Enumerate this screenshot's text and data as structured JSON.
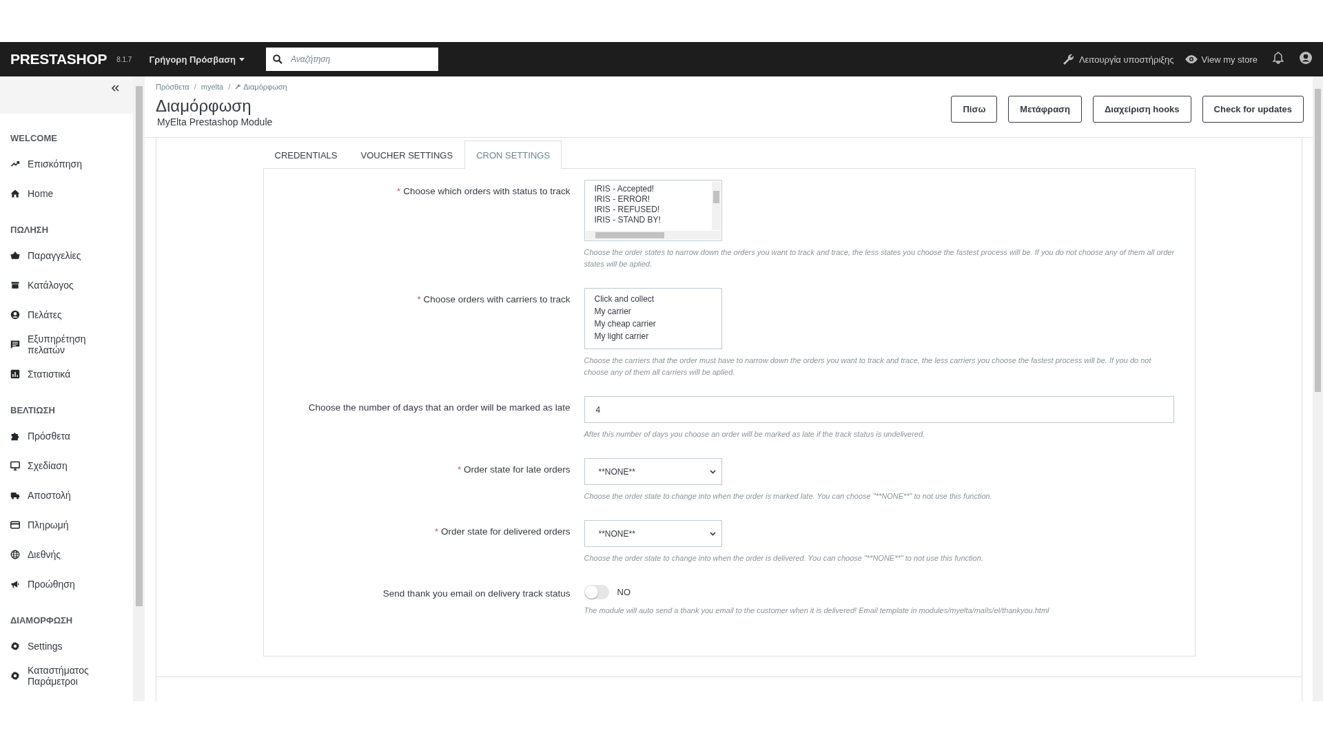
{
  "navbar": {
    "logo": "PRESTASHOP",
    "version": "8.1.7",
    "quick_access": "Γρήγορη Πρόσβαση",
    "search": {
      "placeholder": "Αναζήτηση"
    },
    "maintenance": "Λειτουργία υποστήριξης",
    "view_store": "View my store"
  },
  "sidebar": {
    "sections": [
      {
        "title": "WELCOME",
        "items": [
          {
            "kind": "trend",
            "label": "Επισκόπηση"
          },
          {
            "kind": "home",
            "label": "Home"
          }
        ]
      },
      {
        "title": "ΠΩΛΗΣΗ",
        "items": [
          {
            "kind": "basket",
            "label": "Παραγγελίες"
          },
          {
            "kind": "store",
            "label": "Κατάλογος"
          },
          {
            "kind": "person",
            "label": "Πελάτες"
          },
          {
            "kind": "chat",
            "label": "Εξυπηρέτηση πελατών"
          },
          {
            "kind": "chart",
            "label": "Στατιστικά"
          }
        ]
      },
      {
        "title": "ΒΕΛΤΙΩΣΗ",
        "items": [
          {
            "kind": "puzzle",
            "label": "Πρόσθετα"
          },
          {
            "kind": "monitor",
            "label": "Σχεδίαση"
          },
          {
            "kind": "truck",
            "label": "Αποστολή"
          },
          {
            "kind": "card",
            "label": "Πληρωμή"
          },
          {
            "kind": "globe",
            "label": "Διεθνής"
          },
          {
            "kind": "megaphone",
            "label": "Προώθηση"
          }
        ]
      },
      {
        "title": "ΔΙΑΜΟΡΦΩΣΗ",
        "items": [
          {
            "kind": "gear",
            "label": "Settings"
          },
          {
            "kind": "gear",
            "label": "Καταστήματος Παράμετροι"
          }
        ]
      }
    ]
  },
  "breadcrumb": [
    "Πρόσθετα",
    "myelta",
    "Διαμόρφωση"
  ],
  "breadcrumb_separator": "/",
  "required_mark": "*",
  "page_title": "Διαμόρφωση",
  "page_subtitle": "MyElta Prestashop Module",
  "toolbar_buttons": [
    "Πίσω",
    "Μετάφραση",
    "Διαχείριση hooks",
    "Check for updates"
  ],
  "tabs": [
    {
      "label": "CREDENTIALS",
      "selected": false
    },
    {
      "label": "VOUCHER SETTINGS",
      "selected": false
    },
    {
      "label": "CRON SETTINGS",
      "selected": true
    }
  ],
  "fields": [
    {
      "kind": "listbox",
      "required": true,
      "label": "Choose which orders with status to track",
      "options": [
        "IRIS - Accepted!",
        "IRIS - ERROR!",
        "IRIS - REFUSED!",
        "IRIS - STAND BY!"
      ],
      "help": "Choose the order states to narrow down the orders you want to track and trace, the less states you choose the fastest process will be. If you do not choose any of them all order states will be aplied."
    },
    {
      "kind": "listbox",
      "required": true,
      "label": "Choose orders with carriers to track",
      "options": [
        "Click and collect",
        "My carrier",
        "My cheap carrier",
        "My light carrier"
      ],
      "help": "Choose the carriers that the order must have to narrow down the orders you want to track and trace, the less carriers you choose the fastest process will be. If you do not choose any of them all carriers will be aplied."
    },
    {
      "kind": "text",
      "required": false,
      "label": "Choose the number of days that an order will be marked as late",
      "value": "4",
      "help": "After this number of days you choose an order will be marked as late if the track status is undelivered."
    },
    {
      "kind": "select",
      "required": true,
      "label": "Order state for late orders",
      "value": "**NONE**",
      "help": "Choose the order state to change into when the order is marked late. You can choose \"**NONE**\" to not use this function."
    },
    {
      "kind": "select",
      "required": true,
      "label": "Order state for delivered orders",
      "value": "**NONE**",
      "help": "Choose the order state to change into when the order is delivered. You can choose \"**NONE**\" to not use this function."
    },
    {
      "kind": "switch",
      "required": false,
      "label": "Send thank you email on delivery track status",
      "on": false,
      "value": "NO",
      "help": "The module will auto send a thank you email to the customer when it is delivered! Email template in modules/myelta/mails/el/thankyou.html"
    }
  ]
}
